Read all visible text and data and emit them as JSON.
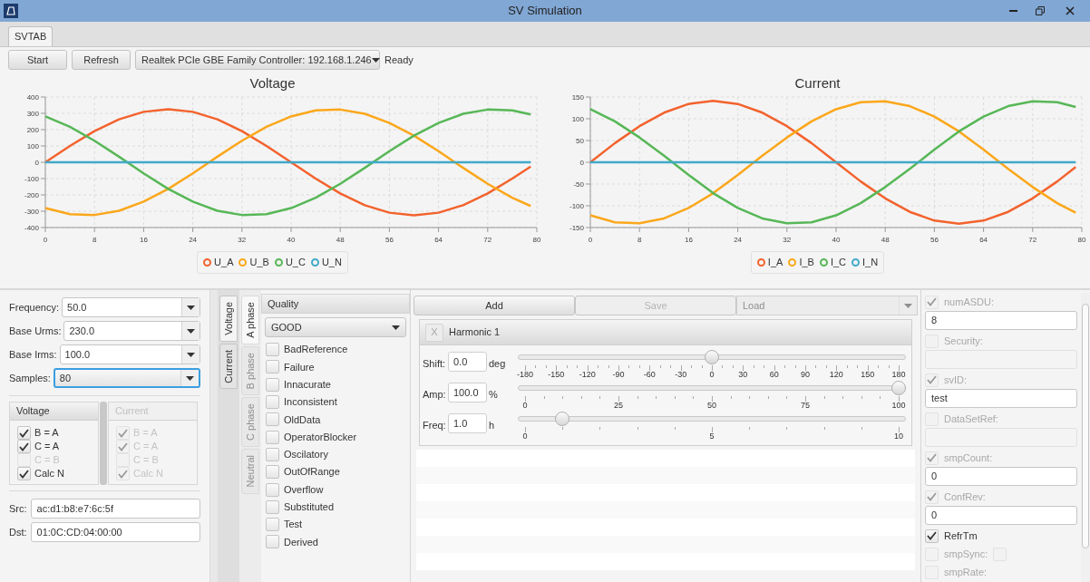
{
  "window": {
    "title": "SV Simulation"
  },
  "tabs": [
    {
      "label": "SVTAB",
      "selected": true
    }
  ],
  "toolbar": {
    "start": "Start",
    "refresh": "Refresh",
    "interface": "Realtek PCIe GBE Family Controller: 192.168.1.246",
    "status": "Ready"
  },
  "charts": [
    {
      "chart_data": {
        "type": "line",
        "grid": true,
        "title": "Voltage",
        "x": [
          0,
          4,
          8,
          12,
          16,
          20,
          24,
          28,
          32,
          36,
          40,
          44,
          48,
          52,
          56,
          60,
          64,
          68,
          72,
          76,
          79
        ],
        "xlim": [
          0,
          80
        ],
        "ylim": [
          -400,
          400
        ],
        "xticks": [
          0,
          8,
          16,
          24,
          32,
          40,
          48,
          56,
          64,
          72,
          80
        ],
        "yticks": [
          -400,
          -300,
          -200,
          -100,
          0,
          100,
          200,
          300,
          400
        ],
        "series": [
          {
            "name": "U_A",
            "color": "#f3622d",
            "values": [
              0,
              100,
              191,
              263,
              309,
              325,
              309,
              263,
              191,
              100,
              0,
              -100,
              -191,
              -263,
              -309,
              -325,
              -309,
              -263,
              -191,
              -100,
              -26
            ]
          },
          {
            "name": "U_B",
            "color": "#fba71b",
            "values": [
              -281,
              -318,
              -323,
              -297,
              -241,
              -163,
              -68,
              34,
              132,
              217,
              281,
              318,
              323,
              297,
              241,
              163,
              68,
              -34,
              -132,
              -217,
              -268
            ]
          },
          {
            "name": "U_C",
            "color": "#57b757",
            "values": [
              281,
              217,
              132,
              34,
              -68,
              -163,
              -241,
              -297,
              -323,
              -318,
              -281,
              -217,
              -132,
              -34,
              68,
              163,
              241,
              297,
              323,
              318,
              293
            ]
          },
          {
            "name": "U_N",
            "color": "#41a9c9",
            "values": [
              0,
              0,
              0,
              0,
              0,
              0,
              0,
              0,
              0,
              0,
              0,
              0,
              0,
              0,
              0,
              0,
              0,
              0,
              0,
              0,
              0
            ]
          }
        ]
      }
    },
    {
      "chart_data": {
        "type": "line",
        "grid": true,
        "title": "Current",
        "x": [
          0,
          4,
          8,
          12,
          16,
          20,
          24,
          28,
          32,
          36,
          40,
          44,
          48,
          52,
          56,
          60,
          64,
          68,
          72,
          76,
          79
        ],
        "xlim": [
          0,
          80
        ],
        "ylim": [
          -150,
          150
        ],
        "xticks": [
          0,
          8,
          16,
          24,
          32,
          40,
          48,
          56,
          64,
          72,
          80
        ],
        "yticks": [
          -150,
          -100,
          -50,
          0,
          50,
          100,
          150
        ],
        "series": [
          {
            "name": "I_A",
            "color": "#f3622d",
            "values": [
              0,
              44,
              83,
              114,
              134,
              141,
              134,
              114,
              83,
              44,
              0,
              -44,
              -83,
              -114,
              -134,
              -141,
              -134,
              -114,
              -83,
              -44,
              -11
            ]
          },
          {
            "name": "I_B",
            "color": "#fba71b",
            "values": [
              -122,
              -138,
              -140,
              -129,
              -105,
              -71,
              -29,
              15,
              57,
              94,
              122,
              138,
              140,
              129,
              105,
              71,
              29,
              -15,
              -57,
              -94,
              -116
            ]
          },
          {
            "name": "I_C",
            "color": "#57b757",
            "values": [
              122,
              94,
              57,
              15,
              -29,
              -71,
              -105,
              -129,
              -140,
              -138,
              -122,
              -94,
              -57,
              -15,
              29,
              71,
              105,
              129,
              140,
              138,
              127
            ]
          },
          {
            "name": "I_N",
            "color": "#41a9c9",
            "values": [
              0,
              0,
              0,
              0,
              0,
              0,
              0,
              0,
              0,
              0,
              0,
              0,
              0,
              0,
              0,
              0,
              0,
              0,
              0,
              0,
              0
            ]
          }
        ]
      }
    }
  ],
  "settings": [
    {
      "label": "Frequency:",
      "value": "50.0",
      "focused": false
    },
    {
      "label": "Base Urms:",
      "value": "230.0",
      "focused": false
    },
    {
      "label": "Base Irms:",
      "value": "100.0",
      "focused": false
    },
    {
      "label": "Samples:",
      "value": "80",
      "focused": true
    }
  ],
  "channel_groups": [
    {
      "title": "Voltage",
      "disabled": false,
      "checks": [
        {
          "label": "B = A",
          "checked": true,
          "disabled": false
        },
        {
          "label": "C = A",
          "checked": true,
          "disabled": false
        },
        {
          "label": "C = B",
          "checked": false,
          "disabled": true
        },
        {
          "label": "Calc N",
          "checked": true,
          "disabled": false
        }
      ]
    },
    {
      "title": "Current",
      "disabled": true,
      "checks": [
        {
          "label": "B = A",
          "checked": true,
          "disabled": true
        },
        {
          "label": "C = A",
          "checked": true,
          "disabled": true
        },
        {
          "label": "C = B",
          "checked": false,
          "disabled": true
        },
        {
          "label": "Calc N",
          "checked": true,
          "disabled": true
        }
      ]
    }
  ],
  "addresses": [
    {
      "label": "Src:",
      "value": "ac:d1:b8:e7:6c:5f"
    },
    {
      "label": "Dst:",
      "value": "01:0C:CD:04:00:00"
    }
  ],
  "side_tabs": [
    {
      "label": "Voltage",
      "selected": true
    },
    {
      "label": "Current",
      "selected": false
    }
  ],
  "phase_tabs": [
    {
      "label": "A phase",
      "selected": true,
      "disabled": false
    },
    {
      "label": "B phase",
      "selected": false,
      "disabled": true
    },
    {
      "label": "C phase",
      "selected": false,
      "disabled": true
    },
    {
      "label": "Neutral",
      "selected": false,
      "disabled": true
    }
  ],
  "quality": {
    "title": "Quality",
    "value": "GOOD",
    "flags": [
      {
        "label": "BadReference",
        "checked": false
      },
      {
        "label": "Failure",
        "checked": false
      },
      {
        "label": "Innacurate",
        "checked": false
      },
      {
        "label": "Inconsistent",
        "checked": false
      },
      {
        "label": "OldData",
        "checked": false
      },
      {
        "label": "OperatorBlocker",
        "checked": false
      },
      {
        "label": "Oscilatory",
        "checked": false
      },
      {
        "label": "OutOfRange",
        "checked": false
      },
      {
        "label": "Overflow",
        "checked": false
      },
      {
        "label": "Substituted",
        "checked": false
      },
      {
        "label": "Test",
        "checked": false
      },
      {
        "label": "Derived",
        "checked": false
      }
    ]
  },
  "harmonics": {
    "buttons": [
      {
        "label": "Add",
        "disabled": false
      },
      {
        "label": "Save",
        "disabled": true
      }
    ],
    "load": {
      "label": "Load",
      "disabled": true
    },
    "items": [
      {
        "close": "X",
        "title": "Harmonic 1",
        "rows": [
          {
            "label": "Shift:",
            "value": "0.0",
            "unit": "deg",
            "level": 0.5,
            "ticks": [
              "-180",
              "-150",
              "-120",
              "-90",
              "-60",
              "-30",
              "0",
              "30",
              "60",
              "90",
              "120",
              "150",
              "180"
            ]
          },
          {
            "label": "Amp:",
            "value": "100.0",
            "unit": "%",
            "level": 1.0,
            "ticks": [
              "0",
              "25",
              "50",
              "75",
              "100"
            ]
          },
          {
            "label": "Freq:",
            "value": "1.0",
            "unit": "h",
            "level": 0.1,
            "ticks": [
              "0",
              "5",
              "10"
            ]
          }
        ]
      }
    ]
  },
  "asdu_fields": [
    {
      "kind": "field",
      "label": "numASDU:",
      "checked": true,
      "disabled": true,
      "editable": true,
      "value": "8"
    },
    {
      "kind": "field",
      "label": "Security:",
      "checked": false,
      "disabled": true,
      "editable": false
    },
    {
      "kind": "field",
      "label": "svID:",
      "checked": true,
      "disabled": true,
      "editable": true,
      "value": "test"
    },
    {
      "kind": "field",
      "label": "DataSetRef:",
      "checked": false,
      "disabled": true,
      "editable": false
    },
    {
      "kind": "field",
      "label": "smpCount:",
      "checked": true,
      "disabled": true,
      "editable": true,
      "value": "0"
    },
    {
      "kind": "field",
      "label": "ConfRev:",
      "checked": true,
      "disabled": true,
      "editable": true,
      "value": "0"
    },
    {
      "kind": "check",
      "label": "RefrTm",
      "checked": true,
      "disabled": false
    },
    {
      "kind": "check_box",
      "label": "smpSync:",
      "checked": false,
      "disabled": true,
      "box_checked": false
    },
    {
      "kind": "check",
      "label": "smpRate:",
      "checked": false,
      "disabled": true
    }
  ]
}
